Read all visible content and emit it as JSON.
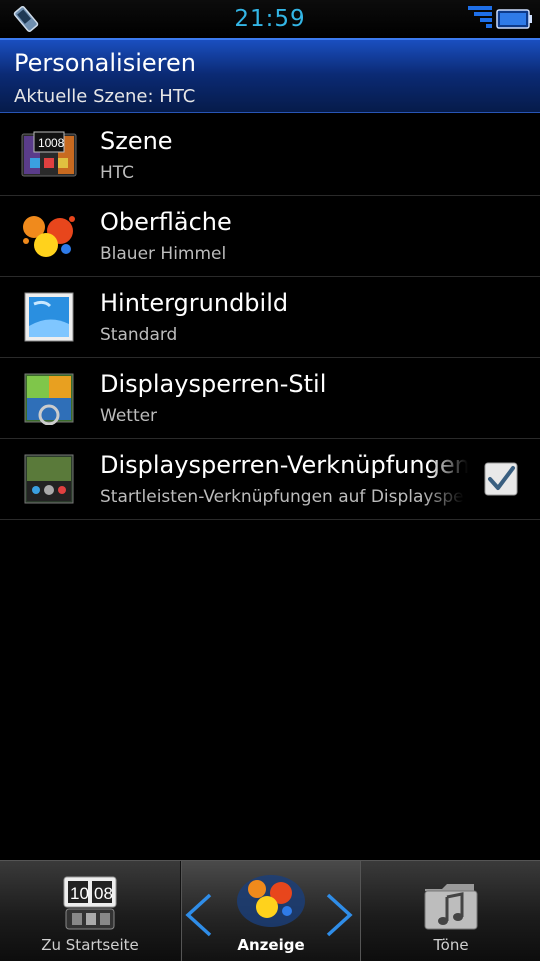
{
  "status": {
    "time": "21:59"
  },
  "header": {
    "title": "Personalisieren",
    "subtitle": "Aktuelle Szene: HTC"
  },
  "items": [
    {
      "label": "Szene",
      "sub": "HTC",
      "icon": "scene-thumbnail-icon"
    },
    {
      "label": "Oberfläche",
      "sub": "Blauer Himmel",
      "icon": "skin-paint-splash-icon"
    },
    {
      "label": "Hintergrundbild",
      "sub": "Standard",
      "icon": "wallpaper-icon"
    },
    {
      "label": "Displaysperren-Stil",
      "sub": "Wetter",
      "icon": "lockscreen-style-icon"
    },
    {
      "label": "Displaysperren-Verknüpfungen",
      "sub": "Startleisten-Verknüpfungen auf Displaysperre",
      "icon": "lockscreen-shortcuts-icon",
      "checked": true
    }
  ],
  "tabs": [
    {
      "label": "Zu Startseite",
      "icon": "home-clock-icon"
    },
    {
      "label": "Anzeige",
      "icon": "display-paint-icon",
      "active": true
    },
    {
      "label": "Töne",
      "icon": "music-folder-icon"
    }
  ],
  "colors": {
    "accent": "#33b5e5",
    "header": "#0b2a74"
  }
}
